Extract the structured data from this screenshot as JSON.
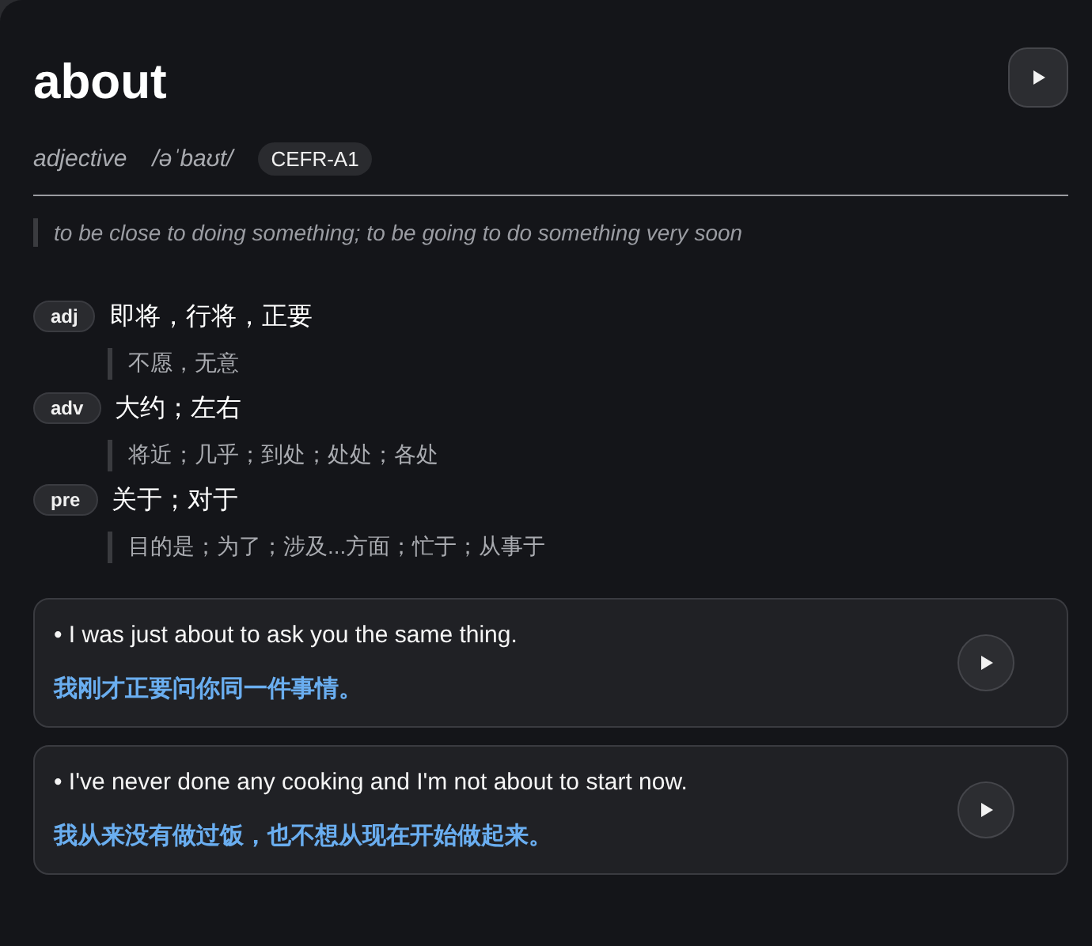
{
  "word": "about",
  "part_of_speech": "adjective",
  "pronunciation": "/əˈbaʊt/",
  "level_badge": "CEFR-A1",
  "definition": "to be close to doing something; to be going to do something very soon",
  "senses": [
    {
      "tag": "adj",
      "meaning": "即将，行将，正要",
      "note": "不愿，无意"
    },
    {
      "tag": "adv",
      "meaning": "大约；左右",
      "note": "将近；几乎；到处；处处；各处"
    },
    {
      "tag": "pre",
      "meaning": "关于；对于",
      "note": "目的是；为了；涉及...方面；忙于；从事于"
    }
  ],
  "examples": [
    {
      "sentence": "• I was just about to ask you the same thing.",
      "translation": "我刚才正要问你同一件事情。"
    },
    {
      "sentence": "• I've never done any cooking and I'm not about to start now.",
      "translation": "我从来没有做过饭，也不想从现在开始做起来。"
    }
  ]
}
